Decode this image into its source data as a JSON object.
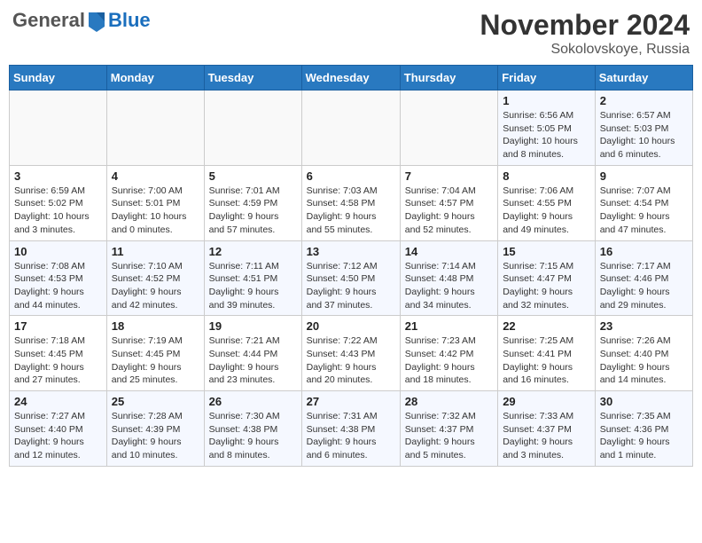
{
  "header": {
    "logo_general": "General",
    "logo_blue": "Blue",
    "month": "November 2024",
    "location": "Sokolovskoye, Russia"
  },
  "weekdays": [
    "Sunday",
    "Monday",
    "Tuesday",
    "Wednesday",
    "Thursday",
    "Friday",
    "Saturday"
  ],
  "weeks": [
    [
      {
        "day": "",
        "info": ""
      },
      {
        "day": "",
        "info": ""
      },
      {
        "day": "",
        "info": ""
      },
      {
        "day": "",
        "info": ""
      },
      {
        "day": "",
        "info": ""
      },
      {
        "day": "1",
        "info": "Sunrise: 6:56 AM\nSunset: 5:05 PM\nDaylight: 10 hours\nand 8 minutes."
      },
      {
        "day": "2",
        "info": "Sunrise: 6:57 AM\nSunset: 5:03 PM\nDaylight: 10 hours\nand 6 minutes."
      }
    ],
    [
      {
        "day": "3",
        "info": "Sunrise: 6:59 AM\nSunset: 5:02 PM\nDaylight: 10 hours\nand 3 minutes."
      },
      {
        "day": "4",
        "info": "Sunrise: 7:00 AM\nSunset: 5:01 PM\nDaylight: 10 hours\nand 0 minutes."
      },
      {
        "day": "5",
        "info": "Sunrise: 7:01 AM\nSunset: 4:59 PM\nDaylight: 9 hours\nand 57 minutes."
      },
      {
        "day": "6",
        "info": "Sunrise: 7:03 AM\nSunset: 4:58 PM\nDaylight: 9 hours\nand 55 minutes."
      },
      {
        "day": "7",
        "info": "Sunrise: 7:04 AM\nSunset: 4:57 PM\nDaylight: 9 hours\nand 52 minutes."
      },
      {
        "day": "8",
        "info": "Sunrise: 7:06 AM\nSunset: 4:55 PM\nDaylight: 9 hours\nand 49 minutes."
      },
      {
        "day": "9",
        "info": "Sunrise: 7:07 AM\nSunset: 4:54 PM\nDaylight: 9 hours\nand 47 minutes."
      }
    ],
    [
      {
        "day": "10",
        "info": "Sunrise: 7:08 AM\nSunset: 4:53 PM\nDaylight: 9 hours\nand 44 minutes."
      },
      {
        "day": "11",
        "info": "Sunrise: 7:10 AM\nSunset: 4:52 PM\nDaylight: 9 hours\nand 42 minutes."
      },
      {
        "day": "12",
        "info": "Sunrise: 7:11 AM\nSunset: 4:51 PM\nDaylight: 9 hours\nand 39 minutes."
      },
      {
        "day": "13",
        "info": "Sunrise: 7:12 AM\nSunset: 4:50 PM\nDaylight: 9 hours\nand 37 minutes."
      },
      {
        "day": "14",
        "info": "Sunrise: 7:14 AM\nSunset: 4:48 PM\nDaylight: 9 hours\nand 34 minutes."
      },
      {
        "day": "15",
        "info": "Sunrise: 7:15 AM\nSunset: 4:47 PM\nDaylight: 9 hours\nand 32 minutes."
      },
      {
        "day": "16",
        "info": "Sunrise: 7:17 AM\nSunset: 4:46 PM\nDaylight: 9 hours\nand 29 minutes."
      }
    ],
    [
      {
        "day": "17",
        "info": "Sunrise: 7:18 AM\nSunset: 4:45 PM\nDaylight: 9 hours\nand 27 minutes."
      },
      {
        "day": "18",
        "info": "Sunrise: 7:19 AM\nSunset: 4:45 PM\nDaylight: 9 hours\nand 25 minutes."
      },
      {
        "day": "19",
        "info": "Sunrise: 7:21 AM\nSunset: 4:44 PM\nDaylight: 9 hours\nand 23 minutes."
      },
      {
        "day": "20",
        "info": "Sunrise: 7:22 AM\nSunset: 4:43 PM\nDaylight: 9 hours\nand 20 minutes."
      },
      {
        "day": "21",
        "info": "Sunrise: 7:23 AM\nSunset: 4:42 PM\nDaylight: 9 hours\nand 18 minutes."
      },
      {
        "day": "22",
        "info": "Sunrise: 7:25 AM\nSunset: 4:41 PM\nDaylight: 9 hours\nand 16 minutes."
      },
      {
        "day": "23",
        "info": "Sunrise: 7:26 AM\nSunset: 4:40 PM\nDaylight: 9 hours\nand 14 minutes."
      }
    ],
    [
      {
        "day": "24",
        "info": "Sunrise: 7:27 AM\nSunset: 4:40 PM\nDaylight: 9 hours\nand 12 minutes."
      },
      {
        "day": "25",
        "info": "Sunrise: 7:28 AM\nSunset: 4:39 PM\nDaylight: 9 hours\nand 10 minutes."
      },
      {
        "day": "26",
        "info": "Sunrise: 7:30 AM\nSunset: 4:38 PM\nDaylight: 9 hours\nand 8 minutes."
      },
      {
        "day": "27",
        "info": "Sunrise: 7:31 AM\nSunset: 4:38 PM\nDaylight: 9 hours\nand 6 minutes."
      },
      {
        "day": "28",
        "info": "Sunrise: 7:32 AM\nSunset: 4:37 PM\nDaylight: 9 hours\nand 5 minutes."
      },
      {
        "day": "29",
        "info": "Sunrise: 7:33 AM\nSunset: 4:37 PM\nDaylight: 9 hours\nand 3 minutes."
      },
      {
        "day": "30",
        "info": "Sunrise: 7:35 AM\nSunset: 4:36 PM\nDaylight: 9 hours\nand 1 minute."
      }
    ]
  ]
}
